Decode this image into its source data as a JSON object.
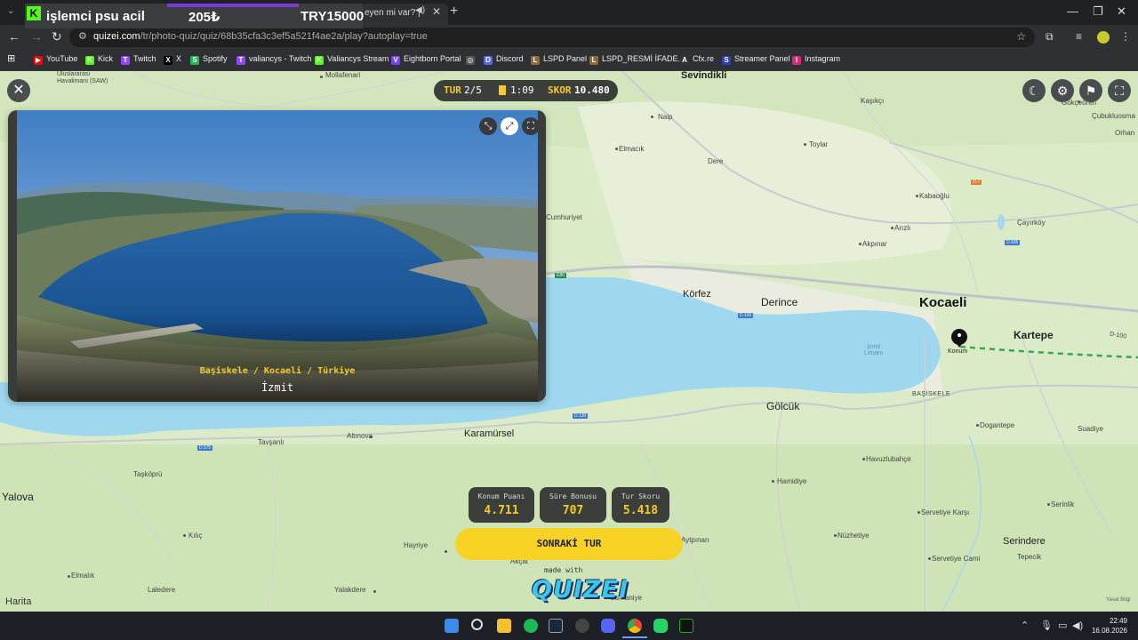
{
  "browser": {
    "promo": {
      "line1": "işlemci psu acil",
      "line2": "205₺",
      "line3": "TRY15000"
    },
    "tab_title": "eyen mi var? | ",
    "url_domain": "quizei.com",
    "url_path": "/tr/photo-quiz/quiz/68b35cfa3c3ef5a521f4ae2a/play?autoplay=true",
    "bookmarks": [
      {
        "label": "YouTube",
        "color": "#ff0000",
        "glyph": "▶"
      },
      {
        "label": "Kick",
        "color": "#53fc18",
        "glyph": "K"
      },
      {
        "label": "Twitch",
        "color": "#9146ff",
        "glyph": "T"
      },
      {
        "label": "X",
        "color": "#000000",
        "glyph": "X"
      },
      {
        "label": "Spotify",
        "color": "#1db954",
        "glyph": "S"
      },
      {
        "label": "valiancys - Twitch",
        "color": "#9146ff",
        "glyph": "T"
      },
      {
        "label": "Valiancys Stream",
        "color": "#53fc18",
        "glyph": "K"
      },
      {
        "label": "Eightborn Portal",
        "color": "#7b3cff",
        "glyph": "V"
      },
      {
        "label": "",
        "color": "#555555",
        "glyph": "◎"
      },
      {
        "label": "Discord",
        "color": "#5865f2",
        "glyph": "D"
      },
      {
        "label": "LSPD Panel",
        "color": "#8a6d3b",
        "glyph": "L"
      },
      {
        "label": "LSPD_RESMİ İFADE...",
        "color": "#8a6d3b",
        "glyph": "L"
      },
      {
        "label": "Cfx.re",
        "color": "#333333",
        "glyph": "A"
      },
      {
        "label": "Streamer Panel",
        "color": "#2b3fbf",
        "glyph": "S"
      },
      {
        "label": "Instagram",
        "color": "#d62976",
        "glyph": "I"
      }
    ]
  },
  "hud": {
    "round_label": "TUR",
    "round_value": "2/5",
    "time": "1:09",
    "score_label": "SKOR",
    "score_value": "10.480"
  },
  "photo": {
    "caption_location": "Başiskele / Kocaeli / Türkiye",
    "caption_title": "İzmit"
  },
  "scores": [
    {
      "label": "Konum Puanı",
      "value": "4.711"
    },
    {
      "label": "Süre Bonusu",
      "value": "707"
    },
    {
      "label": "Tur Skoru",
      "value": "5.418"
    }
  ],
  "next_button": "SONRAKİ TUR",
  "made_with": "made with",
  "brand": "QUIZEI",
  "map": {
    "attribution": "Harita",
    "legal": "Yasal Bilgi",
    "marker_label": "Konum",
    "labels": {
      "airport": "Uluslararası\nHavalimanı (SAW)",
      "mollafenari": "Mollafenari",
      "sevindikli": "Sevindikli",
      "kasikci": "Kaşıkçı",
      "gokcedere": "Gökçeören",
      "cubuklu": "Çubukluosma",
      "orhan": "Orhan",
      "naip": "Naip",
      "elmacik": "Elmacık",
      "toylar": "Toylar",
      "dere": "Dere",
      "kabaoglu": "Kabaoğlu",
      "cayirkoy": "Çayırköy",
      "arizli": "Arızlı",
      "cumhuriyet": "Cumhuriyet",
      "akpinar": "Akpınar",
      "korfez": "Körfez",
      "derince": "Derince",
      "kocaeli": "Kocaeli",
      "kartepe": "Kartepe",
      "izmit_limani": "İzmit\nLimanı",
      "basiskele": "BAŞİSKELE",
      "golcuk": "Gölcük",
      "dogantepe": "Dogantepe",
      "suadiye": "Suadiye",
      "havuzlubahce": "Havuzlubahçe",
      "tavsanli": "Tavşanlı",
      "altinova": "Altınova",
      "karamursel": "Karamürsel",
      "yalova": "Yalova",
      "taskopru": "Taşköprü",
      "hamidiye": "Hamidiye",
      "serinlik": "Serinlik",
      "servetiye_karsi": "Servetiye Karşı",
      "nuzhetiye": "Nüzhetiye",
      "serindere": "Serindere",
      "tepecik": "Tepecik",
      "servetiye_cami": "Servetiye Cami",
      "kilic": "Kılıç",
      "hayriye": "Hayriye",
      "aytpinari": "Aytpınarı",
      "akcat": "Akçat",
      "elmalik": "Elmalık",
      "laledere": "Laledere",
      "yalakdere": "Yalakdere",
      "osmaniye": "Osmaniye",
      "d100": "D-100"
    }
  },
  "taskbar": {
    "time": "22:49",
    "date": "16.08.2026"
  }
}
